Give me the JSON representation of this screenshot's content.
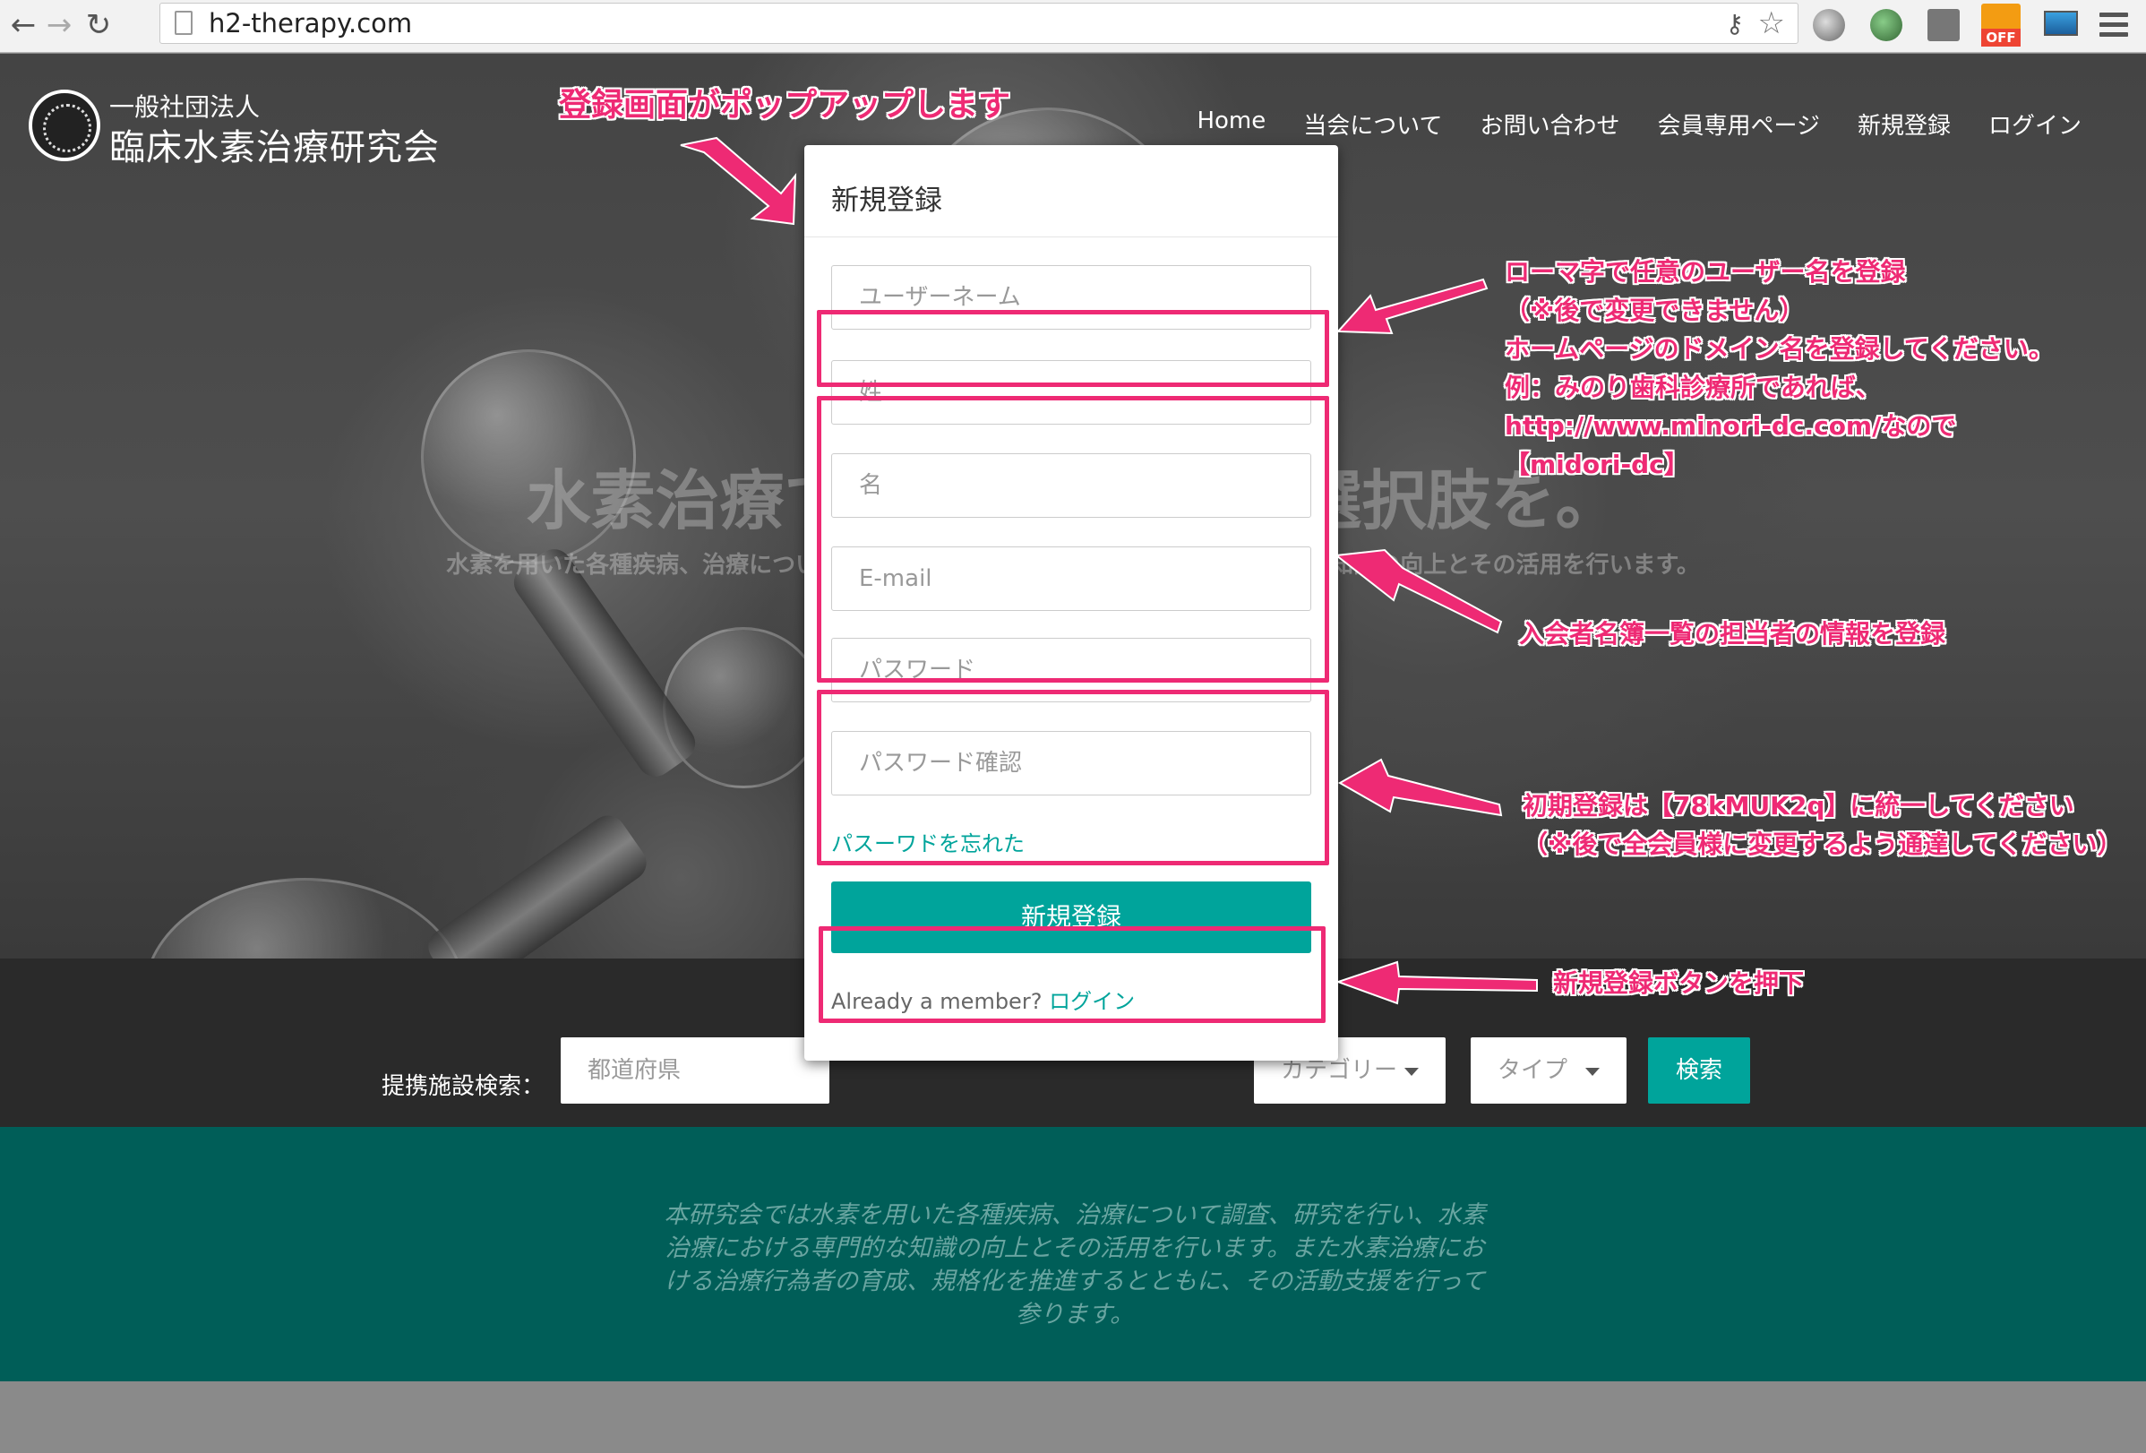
{
  "browser": {
    "url": "h2-therapy.com",
    "back_icon": "arrow-left-icon",
    "forward_icon": "arrow-right-icon",
    "reload_icon": "reload-icon",
    "off_badge": "OFF"
  },
  "header": {
    "org_subtitle": "一般社団法人",
    "org_name": "臨床水素治療研究会",
    "nav": [
      "Home",
      "当会について",
      "お問い合わせ",
      "会員専用ページ",
      "新規登録",
      "ログイン"
    ]
  },
  "hero": {
    "title": "水素治療で、新しい治療の選択肢を。",
    "subtitle": "水素を用いた各種疾病、治療について調査、研究を行い、水素治療における専門的な知識の向上とその活用を行います。"
  },
  "search": {
    "label": "提携施設検索：",
    "prefecture_placeholder": "都道府県",
    "category_placeholder": "カテゴリー",
    "type_placeholder": "タイプ",
    "button": "検索"
  },
  "about": {
    "text": "本研究会では水素を用いた各種疾病、治療について調査、研究を行い、水素治療における専門的な知識の向上とその活用を行います。また水素治療における治療行為者の育成、規格化を推進するとともに、その活動支援を行って参ります。"
  },
  "modal": {
    "title": "新規登録",
    "username_placeholder": "ユーザーネーム",
    "last_name_placeholder": "姓",
    "first_name_placeholder": "名",
    "email_placeholder": "E-mail",
    "password_placeholder": "パスワード",
    "password_confirm_placeholder": "パスワード確認",
    "forgot_link": "パスーワドを忘れた",
    "submit": "新規登録",
    "already_text": "Already a member?",
    "login_link": "ログイン"
  },
  "annotations": {
    "popup": "登録画面がポップアップします",
    "username_lines": [
      "ローマ字で任意のユーザー名を登録",
      "（※後で変更できません）",
      "ホームページのドメイン名を登録してください。",
      "例：みのり歯科診療所であれば、",
      "http://www.minori-dc.com/なので",
      "【midori-dc】"
    ],
    "member_info": "入会者名簿一覧の担当者の情報を登録",
    "password_lines": [
      "初期登録は【78kMUK2q】に統一してください",
      "（※後で全会員様に変更するよう通達してください）"
    ],
    "submit_note": "新規登録ボタンを押下",
    "highlight_color": "#ee2a74",
    "accent_color": "#00a49b"
  }
}
